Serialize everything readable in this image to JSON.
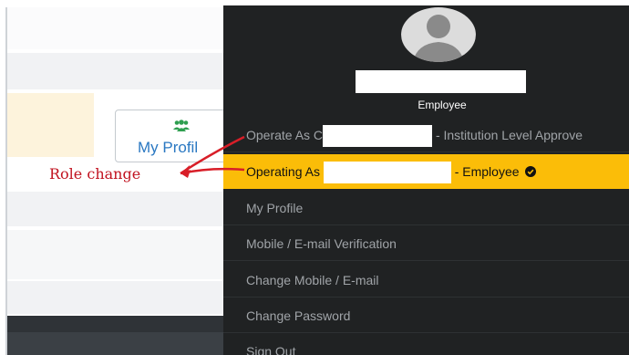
{
  "annotation": {
    "label": "Role change",
    "color": "#c1121f"
  },
  "profile_card": {
    "label": "My Profil",
    "icon": "users-icon",
    "icon_color": "#2e9e4f",
    "label_color": "#2a78c2"
  },
  "user": {
    "role_caption": "Employee"
  },
  "menu": {
    "operate_as": {
      "prefix": "Operate As C",
      "suffix": "- Institution Level Approve"
    },
    "operating_as": {
      "prefix": "Operating As",
      "suffix": "- Employee"
    },
    "items": [
      {
        "label": "My Profile"
      },
      {
        "label": "Mobile / E-mail Verification"
      },
      {
        "label": "Change Mobile / E-mail"
      },
      {
        "label": "Change Password"
      },
      {
        "label": "Sign Out"
      }
    ],
    "accent": "#fbbd08",
    "background": "#202223"
  }
}
